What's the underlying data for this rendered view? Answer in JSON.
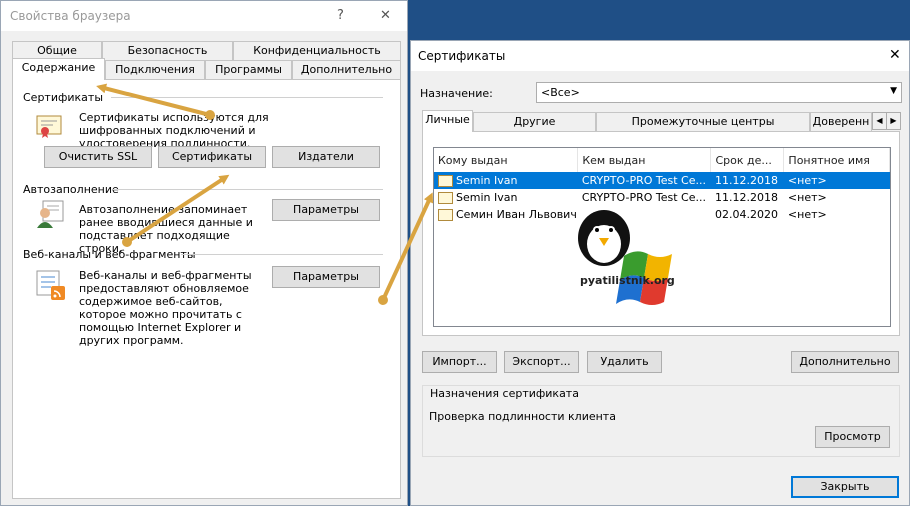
{
  "left_window": {
    "title": "Свойства браузера",
    "help_icon": "?",
    "close_icon": "✕",
    "tabs_row1": [
      "Общие",
      "Безопасность",
      "Конфиденциальность"
    ],
    "tabs_row2": [
      "Содержание",
      "Подключения",
      "Программы",
      "Дополнительно"
    ],
    "certificates": {
      "heading": "Сертификаты",
      "description": "Сертификаты используются для шифрованных подключений и удостоверения подлинности.",
      "buttons": [
        "Очистить SSL",
        "Сертификаты",
        "Издатели"
      ]
    },
    "autocomplete": {
      "heading": "Автозаполнение",
      "description": "Автозаполнение запоминает ранее вводившиеся данные и подставляет подходящие строки.",
      "button": "Параметры"
    },
    "feeds": {
      "heading": "Веб-каналы и веб-фрагменты",
      "description": "Веб-каналы и веб-фрагменты предоставляют обновляемое содержимое веб-сайтов, которое можно прочитать с помощью Internet Explorer и других программ.",
      "button": "Параметры"
    }
  },
  "right_window": {
    "title": "Сертификаты",
    "close_icon": "✕",
    "purpose_label": "Назначение:",
    "purpose_value": "<Все>",
    "tabs": [
      "Личные",
      "Другие пользователи",
      "Промежуточные центры сертификации",
      "Доверенн"
    ],
    "columns": [
      "Кому выдан",
      "Кем выдан",
      "Срок де...",
      "Понятное имя"
    ],
    "rows": [
      {
        "issued_to": "Semin Ivan",
        "issued_by": "CRYPTO-PRO Test Ce...",
        "expires": "11.12.2018",
        "friendly": "<нет>",
        "selected": true
      },
      {
        "issued_to": "Semin Ivan",
        "issued_by": "CRYPTO-PRO Test Ce...",
        "expires": "11.12.2018",
        "friendly": "<нет>",
        "selected": false
      },
      {
        "issued_to": "Семин Иван Львович",
        "issued_by": "",
        "expires": "02.04.2020",
        "friendly": "<нет>",
        "selected": false
      }
    ],
    "buttons": {
      "import": "Импорт...",
      "export": "Экспорт...",
      "delete": "Удалить",
      "advanced": "Дополнительно",
      "view": "Просмотр",
      "close": "Закрыть"
    },
    "purposes_heading": "Назначения сертификата",
    "purposes_text": "Проверка подлинности клиента",
    "watermark": "pyatilistnik.org"
  },
  "colors": {
    "accent": "#0078d7",
    "arrow": "#d9a441",
    "desktop": "#1f4f86"
  }
}
